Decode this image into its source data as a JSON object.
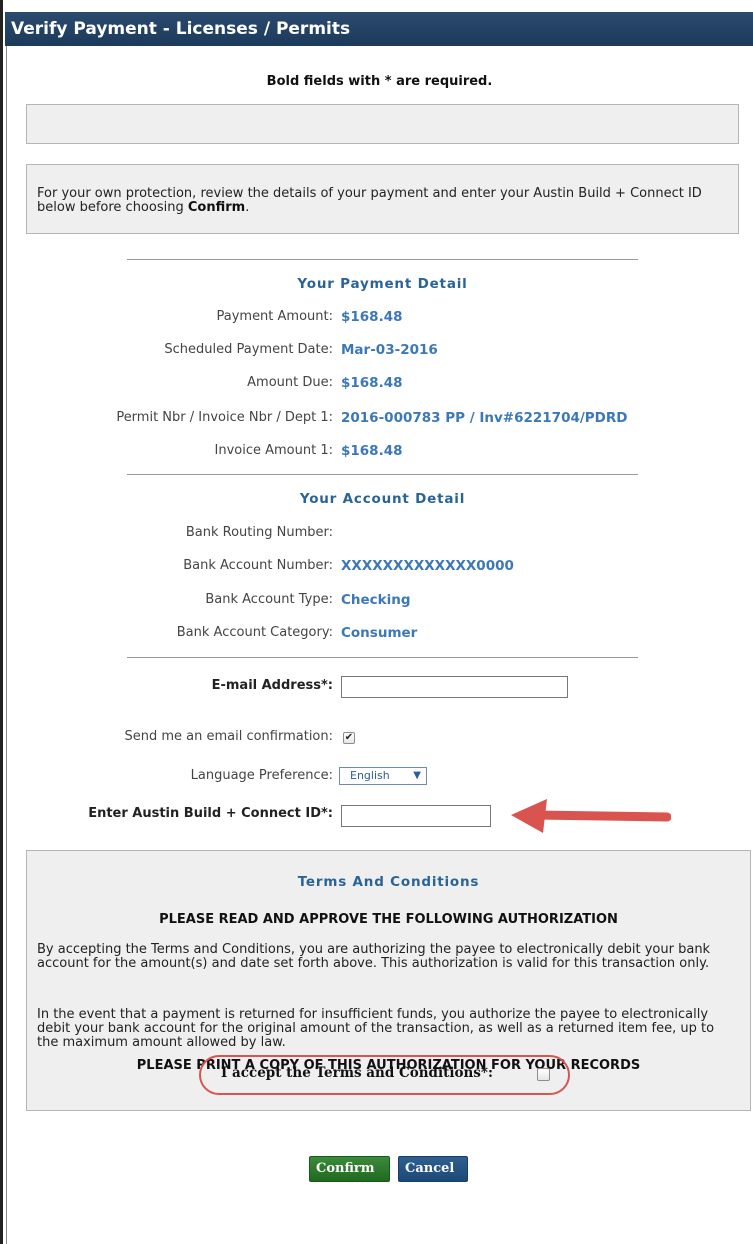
{
  "window": {
    "title": "Verify Payment - Licenses / Permits"
  },
  "required_note": "Bold fields with * are required.",
  "info": {
    "text_before": "For your own protection, review the details of your payment and enter your Austin Build + Connect ID below before choosing ",
    "bold_word": "Confirm",
    "text_after": "."
  },
  "payment_detail": {
    "title": "Your Payment Detail",
    "rows": [
      {
        "label": "Payment Amount:",
        "value": "$168.48"
      },
      {
        "label": "Scheduled Payment Date:",
        "value": "Mar-03-2016"
      },
      {
        "label": "Amount Due:",
        "value": "$168.48"
      },
      {
        "label": "Permit Nbr / Invoice Nbr / Dept 1:",
        "value": "2016-000783 PP / Inv#6221704/PDRD"
      },
      {
        "label": "Invoice Amount 1:",
        "value": "$168.48"
      }
    ]
  },
  "account_detail": {
    "title": "Your Account Detail",
    "rows": [
      {
        "label": "Bank Routing Number:",
        "value": ""
      },
      {
        "label": "Bank Account Number:",
        "value": "XXXXXXXXXXXXX0000"
      },
      {
        "label": "Bank Account Type:",
        "value": "Checking"
      },
      {
        "label": "Bank Account Category:",
        "value": "Consumer"
      }
    ]
  },
  "form": {
    "email_label": "E-mail Address*:",
    "email_value": "",
    "email_confirm_label": "Send me an email confirmation:",
    "email_confirm_checked": true,
    "language_label": "Language Preference:",
    "language_value": "English",
    "abc_id_label": "Enter Austin Build + Connect ID*:",
    "abc_id_value": ""
  },
  "terms": {
    "title": "Terms And Conditions",
    "heading": "PLEASE READ AND APPROVE THE FOLLOWING AUTHORIZATION",
    "paragraph1": "By accepting the Terms and Conditions, you are authorizing the payee to electronically debit your bank account for the amount(s) and date set forth above. This authorization is valid for this transaction only.",
    "paragraph2": "In the event that a payment is returned for insufficient funds, you authorize the payee to electronically debit your bank account for the original amount of the transaction, as well as a returned item fee, up to the maximum amount allowed by law.",
    "print_notice": "PLEASE PRINT A COPY OF THIS AUTHORIZATION FOR YOUR RECORDS",
    "accept_label": "I accept the Terms and Conditions*:",
    "accept_checked": false
  },
  "buttons": {
    "confirm": "Confirm",
    "cancel": "Cancel"
  },
  "colors": {
    "header_bg": "#1b3a5c",
    "accent": "#2a6496",
    "value_text": "#3c78b8",
    "annotation": "#d9534f",
    "confirm_bg": "#1f6a1f",
    "cancel_bg": "#1c4a78"
  }
}
